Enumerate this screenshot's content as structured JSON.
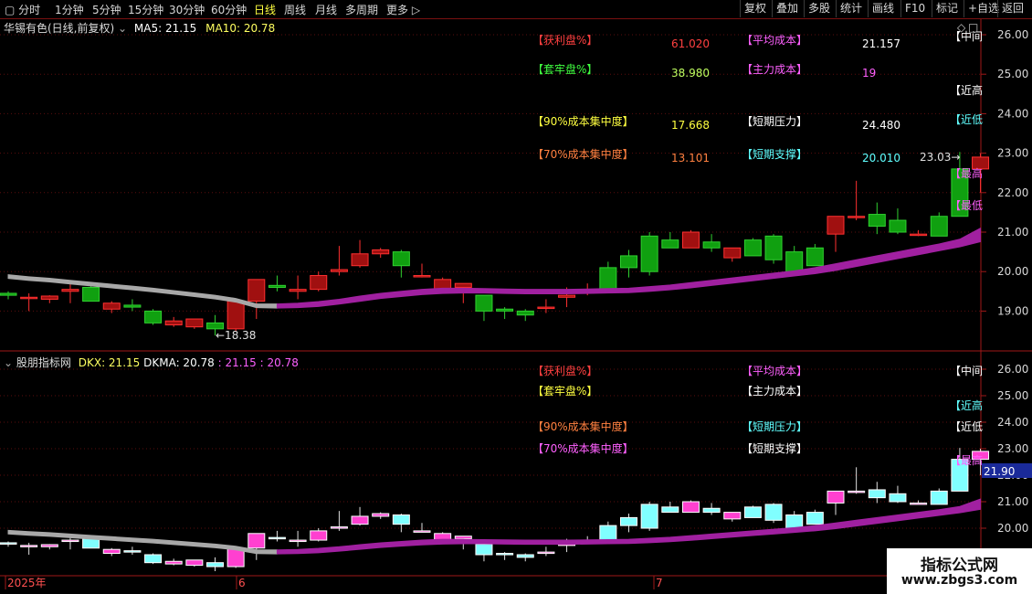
{
  "toolbar": {
    "periods": [
      "分时",
      "1分钟",
      "5分钟",
      "15分钟",
      "30分钟",
      "60分钟",
      "日线",
      "周线",
      "月线",
      "多周期",
      "更多"
    ],
    "active_period": "日线",
    "right_buttons": [
      "复权",
      "叠加",
      "多股",
      "统计",
      "画线",
      "F10",
      "标记",
      "+自选",
      "返回"
    ]
  },
  "main_panel": {
    "stock_title": "华锡有色(日线,前复权)",
    "ma5_label": "MA5: 21.15",
    "ma10_label": "MA10: 20.78",
    "y_ticks": [
      "26.00",
      "25.00",
      "24.00",
      "23.00",
      "22.00",
      "21.00",
      "20.00",
      "19.00"
    ],
    "low_marker": "18.38",
    "high_marker": "23.03",
    "side_tags": [
      "中间",
      "近高",
      "近低",
      "最高",
      "最低"
    ]
  },
  "info_table": [
    {
      "label": "【获利盘%】",
      "value": "61.020",
      "label2": "【平均成本】",
      "value2": "21.157"
    },
    {
      "label": "【套牢盘%】",
      "value": "38.980",
      "label2": "【主力成本】",
      "value2": "19"
    },
    {
      "label": "【90%成本集中度】",
      "value": "17.668",
      "label2": "【短期压力】",
      "value2": "24.480"
    },
    {
      "label": "【70%成本集中度】",
      "value": "13.101",
      "label2": "【短期支撑】",
      "value2": "20.010"
    }
  ],
  "sub_panel": {
    "indicator_name": "股朋指标网",
    "dkx_label": "DKX: 21.15",
    "dkma_label": "DKMA: 20.78",
    "extra_label": ": 21.15 : 20.78",
    "y_ticks": [
      "26.00",
      "25.00",
      "24.00",
      "23.00",
      "22.00",
      "21.00",
      "20.00"
    ],
    "price_tag": "21.90",
    "labels": [
      "【获利盘%】",
      "【平均成本】",
      "【套牢盘%】",
      "【主力成本】",
      "【90%成本集中度】",
      "【短期压力】",
      "【70%成本集中度】",
      "【短期支撑】"
    ],
    "side_tags": [
      "中间",
      "近高",
      "近低",
      "最高"
    ]
  },
  "x_axis": {
    "labels": [
      "2025年",
      "6",
      "7"
    ]
  },
  "watermark": {
    "line1": "指标公式网",
    "line2": "www.zbgs3.com"
  },
  "chart_data": {
    "type": "candlestick",
    "title": "华锡有色(日线,前复权)",
    "ylim": [
      18.2,
      26.3
    ],
    "series_ohlc": [
      [
        19.45,
        19.5,
        19.3,
        19.4
      ],
      [
        19.35,
        19.45,
        19.0,
        19.35
      ],
      [
        19.3,
        19.4,
        19.2,
        19.38
      ],
      [
        19.5,
        19.7,
        19.2,
        19.55
      ],
      [
        19.6,
        19.65,
        19.25,
        19.25
      ],
      [
        19.05,
        19.25,
        18.95,
        19.2
      ],
      [
        19.15,
        19.3,
        19.0,
        19.1
      ],
      [
        19.0,
        19.05,
        18.65,
        18.7
      ],
      [
        18.65,
        18.85,
        18.6,
        18.75
      ],
      [
        18.6,
        18.8,
        18.55,
        18.8
      ],
      [
        18.7,
        18.9,
        18.38,
        18.55
      ],
      [
        18.55,
        19.3,
        18.5,
        19.25
      ],
      [
        19.25,
        19.6,
        18.8,
        19.8
      ],
      [
        19.65,
        19.9,
        19.5,
        19.6
      ],
      [
        19.5,
        19.9,
        19.3,
        19.55
      ],
      [
        19.55,
        20.0,
        19.5,
        19.9
      ],
      [
        20.0,
        20.65,
        19.9,
        20.05
      ],
      [
        20.15,
        20.8,
        20.1,
        20.45
      ],
      [
        20.45,
        20.6,
        20.35,
        20.55
      ],
      [
        20.5,
        20.55,
        19.85,
        20.15
      ],
      [
        19.9,
        20.2,
        19.85,
        19.9
      ],
      [
        19.55,
        19.85,
        19.5,
        19.8
      ],
      [
        19.6,
        19.7,
        19.2,
        19.7
      ],
      [
        19.4,
        19.4,
        18.75,
        19.0
      ],
      [
        19.05,
        19.1,
        18.8,
        19.0
      ],
      [
        19.0,
        19.05,
        18.75,
        18.9
      ],
      [
        19.1,
        19.3,
        18.95,
        19.1
      ],
      [
        19.35,
        19.6,
        19.1,
        19.4
      ],
      [
        19.55,
        19.7,
        19.4,
        19.55
      ],
      [
        20.1,
        20.25,
        19.5,
        19.5
      ],
      [
        20.4,
        20.55,
        19.85,
        20.1
      ],
      [
        20.9,
        21.0,
        19.9,
        20.0
      ],
      [
        20.8,
        21.0,
        20.6,
        20.6
      ],
      [
        20.6,
        21.05,
        20.6,
        21.0
      ],
      [
        20.75,
        20.95,
        20.5,
        20.6
      ],
      [
        20.35,
        20.55,
        20.25,
        20.6
      ],
      [
        20.8,
        20.85,
        20.4,
        20.4
      ],
      [
        20.9,
        20.95,
        20.2,
        20.3
      ],
      [
        20.5,
        20.65,
        20.0,
        20.0
      ],
      [
        20.6,
        20.7,
        20.25,
        20.15
      ],
      [
        20.95,
        21.3,
        20.5,
        21.4
      ],
      [
        21.4,
        22.3,
        21.3,
        21.4
      ],
      [
        21.45,
        21.75,
        20.95,
        21.15
      ],
      [
        21.3,
        21.6,
        20.95,
        21.0
      ],
      [
        20.95,
        21.05,
        20.9,
        20.95
      ],
      [
        21.4,
        21.5,
        20.9,
        20.9
      ],
      [
        22.6,
        23.03,
        21.4,
        21.4
      ],
      [
        22.6,
        23.0,
        22.0,
        22.9
      ]
    ],
    "ma5": [
      19.92,
      19.87,
      19.83,
      19.78,
      19.73,
      19.68,
      19.63,
      19.58,
      19.52,
      19.46,
      19.4,
      19.32,
      19.18,
      19.18,
      19.2,
      19.24,
      19.3,
      19.38,
      19.45,
      19.5,
      19.55,
      19.58,
      19.58,
      19.57,
      19.56,
      19.55,
      19.55,
      19.55,
      19.56,
      19.57,
      19.58,
      19.62,
      19.66,
      19.72,
      19.78,
      19.84,
      19.9,
      19.96,
      20.02,
      20.1,
      20.2,
      20.3,
      20.4,
      20.5,
      20.6,
      20.7,
      20.82,
      21.1
    ],
    "ma10": [
      19.92,
      19.87,
      19.83,
      19.78,
      19.73,
      19.68,
      19.63,
      19.58,
      19.52,
      19.46,
      19.4,
      19.32,
      19.18,
      19.17,
      19.18,
      19.21,
      19.27,
      19.34,
      19.41,
      19.46,
      19.51,
      19.54,
      19.55,
      19.55,
      19.54,
      19.53,
      19.53,
      19.53,
      19.54,
      19.55,
      19.56,
      19.59,
      19.63,
      19.68,
      19.74,
      19.8,
      19.86,
      19.92,
      19.98,
      20.04,
      20.12,
      20.22,
      20.32,
      20.42,
      20.52,
      20.62,
      20.72,
      20.85
    ]
  }
}
